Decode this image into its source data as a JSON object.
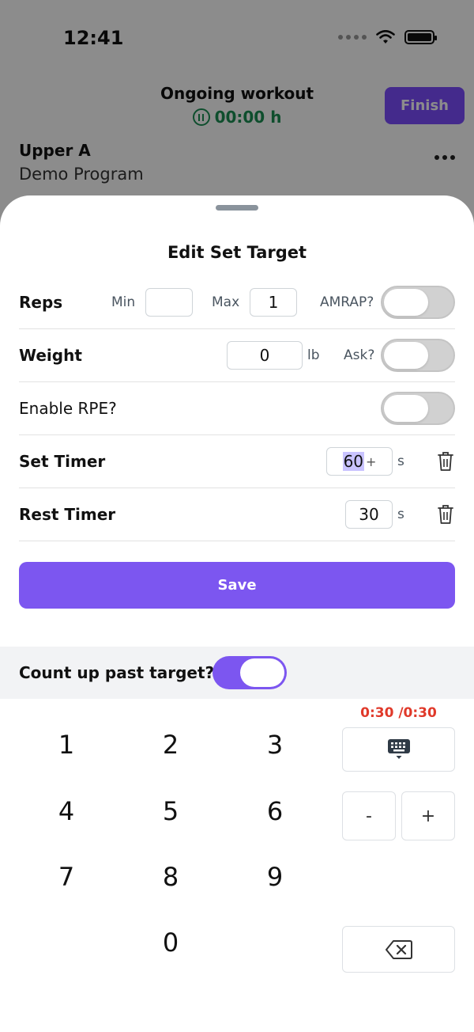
{
  "status_bar": {
    "time": "12:41"
  },
  "workout": {
    "title": "Ongoing workout",
    "timer": "00:00 h",
    "finish_label": "Finish",
    "program_name": "Upper A",
    "program_sub": "Demo Program"
  },
  "sheet": {
    "title": "Edit Set Target",
    "reps": {
      "label": "Reps",
      "min_label": "Min",
      "min_value": "",
      "max_label": "Max",
      "max_value": "1",
      "amrap_label": "AMRAP?",
      "amrap_on": false
    },
    "weight": {
      "label": "Weight",
      "value": "0",
      "unit": "lb",
      "ask_label": "Ask?",
      "ask_on": false
    },
    "rpe": {
      "label": "Enable RPE?",
      "on": false
    },
    "set_timer": {
      "label": "Set Timer",
      "value_selected": "60",
      "cursor_suffix": "+",
      "unit": "s"
    },
    "rest_timer": {
      "label": "Rest Timer",
      "value": "30",
      "unit": "s"
    },
    "save_label": "Save"
  },
  "keyboard": {
    "count_up_label": "Count up past target?",
    "count_up_on": true,
    "timer_readout": "0:30 /0:30",
    "keys": [
      "1",
      "2",
      "3",
      "4",
      "5",
      "6",
      "7",
      "8",
      "9",
      "0"
    ],
    "minus_label": "-",
    "plus_label": "+"
  },
  "colors": {
    "accent": "#7c56f0",
    "timer_green": "#1a8f53",
    "readout_red": "#e0392a"
  }
}
